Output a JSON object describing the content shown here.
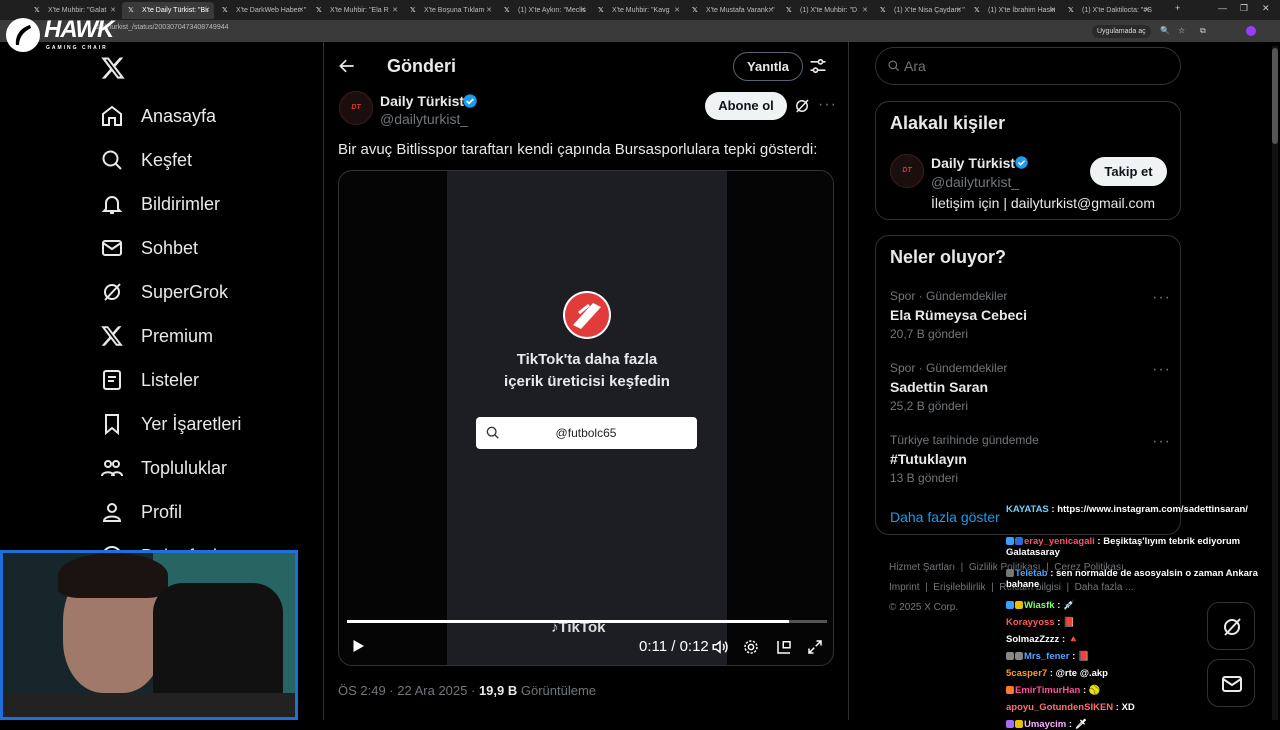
{
  "browser": {
    "tabs": [
      "X'te Muhbir: \"Galat",
      "X'te Daily Türkist: \"Bir",
      "X'te DarkWeb Haber: \"",
      "X'te Muhbir: \"Ela R",
      "X'te Boşuna Tıklam",
      "(1) X'te Aykırı: \"Meclis",
      "X'te Muhbir: \"Kavg",
      "X'te Mustafa Varank: \"",
      "(1) X'te Muhbir: \"D",
      "(1) X'te Nisa Çaydan: \"",
      "(1) X'te İbrahim Haskı",
      "(1) X'te Daktilocta: \"#S"
    ],
    "url": "dailyturkist_/status/2003070473408749944",
    "app_button": "Uygulamada aç"
  },
  "logo": {
    "word": "HAWK",
    "sub": "GAMING CHAIR"
  },
  "sidebar": {
    "items": [
      {
        "label": "Anasayfa",
        "icon": "home-icon"
      },
      {
        "label": "Keşfet",
        "icon": "search-icon"
      },
      {
        "label": "Bildirimler",
        "icon": "bell-icon"
      },
      {
        "label": "Sohbet",
        "icon": "mail-icon"
      },
      {
        "label": "SuperGrok",
        "icon": "grok-icon"
      },
      {
        "label": "Premium",
        "icon": "x-logo-icon"
      },
      {
        "label": "Listeler",
        "icon": "list-icon"
      },
      {
        "label": "Yer İşaretleri",
        "icon": "bookmark-icon"
      },
      {
        "label": "Topluluklar",
        "icon": "communities-icon"
      },
      {
        "label": "Profil",
        "icon": "profile-icon"
      },
      {
        "label": "Daha fazla",
        "icon": "more-icon"
      }
    ]
  },
  "header": {
    "title": "Gönderi",
    "reply_button": "Yanıtla"
  },
  "post": {
    "author_name": "Daily Türkist",
    "author_handle": "@dailyturkist_",
    "subscribe_button": "Abone ol",
    "text": "Bir avuç Bitlisspor taraftarı kendi çapında Bursasporlulara tepki gösterdi:",
    "video": {
      "promo_line1": "TikTok'ta daha fazla",
      "promo_line2": "içerik üreticisi keşfedin",
      "search_value": "@futbolc65",
      "watermark": "TikTok",
      "time": "0:11 / 0:12",
      "progress": 0.92
    },
    "meta_time": "ÖS 2:49 · 22 Ara 2025 ·",
    "views_count": "19,9 B",
    "views_label": "Görüntüleme"
  },
  "search": {
    "placeholder": "Ara"
  },
  "related": {
    "title": "Alakalı kişiler",
    "name": "Daily Türkist",
    "handle": "@dailyturkist_",
    "bio": "İletişim için | dailyturkist@gmail.com",
    "follow_button": "Takip et"
  },
  "trends": {
    "title": "Neler oluyor?",
    "items": [
      {
        "category": "Spor · Gündemdekiler",
        "title": "Ela Rümeysa Cebeci",
        "count": "20,7 B gönderi"
      },
      {
        "category": "Spor · Gündemdekiler",
        "title": "Sadettin Saran",
        "count": "25,2 B gönderi"
      },
      {
        "category": "Türkiye tarihinde gündemde",
        "title": "#Tutuklayın",
        "count": "13 B gönderi"
      }
    ],
    "show_more": "Daha fazla göster"
  },
  "footer": {
    "links": [
      "Hizmet Şartları",
      "Gizlilik Politikası",
      "Çerez Politikası",
      "Imprint",
      "Erişilebilirlik",
      "Reklam bilgisi",
      "Daha fazla ..."
    ],
    "copyright": "© 2025 X Corp."
  },
  "chat": [
    {
      "name": "KAYATAS",
      "color": "#6fd0ff",
      "msg": ": https://www.instagram.com/sadettinsaran/",
      "icons": []
    },
    {
      "name": "eray_yenicagali",
      "color": "#ff4f6b",
      "msg": ": Beşiktaş'lıyım tebrik ediyorum Galatasaray",
      "icons": [
        "#3aa0ff",
        "#2b6bd6"
      ]
    },
    {
      "name": "Teletab",
      "color": "#4fa3ff",
      "msg": ": sen normalde de asosyalsin o zaman Ankara bahane",
      "icons": [
        "#777"
      ]
    },
    {
      "name": "Wiasfk",
      "color": "#7dff6a",
      "msg": ": 💉",
      "icons": [
        "#3aa0ff",
        "#e6c200"
      ]
    },
    {
      "name": "Korayyoss",
      "color": "#ff5a5a",
      "msg": ": 📕",
      "icons": []
    },
    {
      "name": "SolmazZzzz",
      "color": "#ffffff",
      "msg": ": 🔺",
      "icons": []
    },
    {
      "name": "Mrs_fener",
      "color": "#5aa2ff",
      "msg": ": 📕",
      "icons": [
        "#888",
        "#888"
      ]
    },
    {
      "name": "5casper7",
      "color": "#ff9a2a",
      "msg": ": @rte @.akp",
      "icons": []
    },
    {
      "name": "EmirTimurHan",
      "color": "#ff4f9a",
      "msg": ": 🥎",
      "icons": [
        "#ff7a2a"
      ]
    },
    {
      "name": "apoyu_GotundenSIKEN",
      "color": "#ff6f6f",
      "msg": ": XD",
      "icons": []
    },
    {
      "name": "Umaycim",
      "color": "#ffb0ff",
      "msg": ": 🗡",
      "icons": [
        "#a46bff",
        "#e6c200"
      ]
    }
  ],
  "colors": {
    "accent": "#1d9bf0",
    "verified": "#1d9bf0",
    "border": "#2f3336",
    "muted": "#71767b"
  }
}
